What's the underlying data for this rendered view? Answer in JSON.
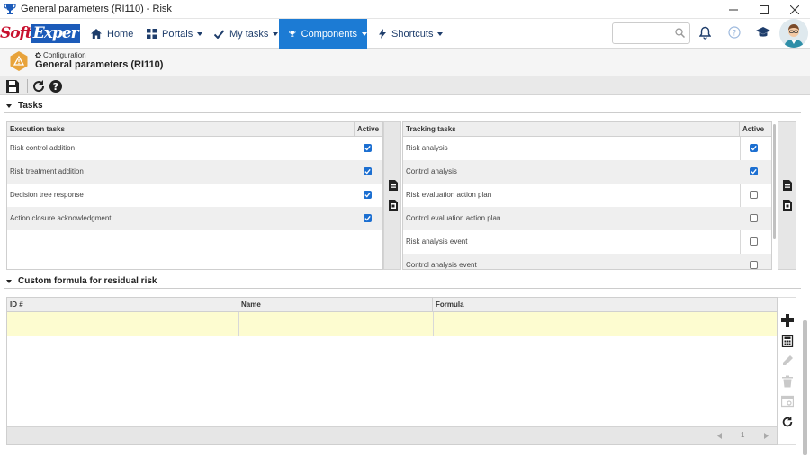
{
  "window": {
    "title": "General parameters (RI110) - Risk",
    "controls": [
      "minimize",
      "maximize",
      "close"
    ]
  },
  "logo": {
    "part1": "Soft",
    "part2": "Exper"
  },
  "nav": {
    "items": [
      {
        "label": "Home",
        "icon": "home-icon"
      },
      {
        "label": "Portals",
        "icon": "portals-icon"
      },
      {
        "label": "My tasks",
        "icon": "check-icon"
      },
      {
        "label": "Components",
        "icon": "trophy-icon",
        "active": true
      },
      {
        "label": "Shortcuts",
        "icon": "bolt-icon"
      }
    ],
    "search": {
      "placeholder": "",
      "value": ""
    }
  },
  "header": {
    "breadcrumb": "Configuration",
    "title": "General parameters (RI110)"
  },
  "sections": {
    "tasks": "Tasks",
    "formula": "Custom formula for residual risk"
  },
  "execution": {
    "col_task": "Execution tasks",
    "col_active": "Active",
    "rows": [
      {
        "task": "Risk control addition",
        "active": true
      },
      {
        "task": "Risk treatment addition",
        "active": true
      },
      {
        "task": "Decision tree response",
        "active": true
      },
      {
        "task": "Action closure acknowledgment",
        "active": true
      }
    ]
  },
  "tracking": {
    "col_task": "Tracking tasks",
    "col_active": "Active",
    "rows": [
      {
        "task": "Risk analysis",
        "active": true
      },
      {
        "task": "Control analysis",
        "active": true
      },
      {
        "task": "Risk evaluation action plan",
        "active": false
      },
      {
        "task": "Control evaluation action plan",
        "active": false
      },
      {
        "task": "Risk analysis event",
        "active": false
      },
      {
        "task": "Control analysis event",
        "active": false
      }
    ]
  },
  "formula_grid": {
    "columns": [
      "ID #",
      "Name",
      "Formula"
    ],
    "page": "1"
  },
  "colors": {
    "accent": "#1c7bd4",
    "selected_row": "#fdfcd0",
    "checkbox": "#1c6fd1"
  }
}
